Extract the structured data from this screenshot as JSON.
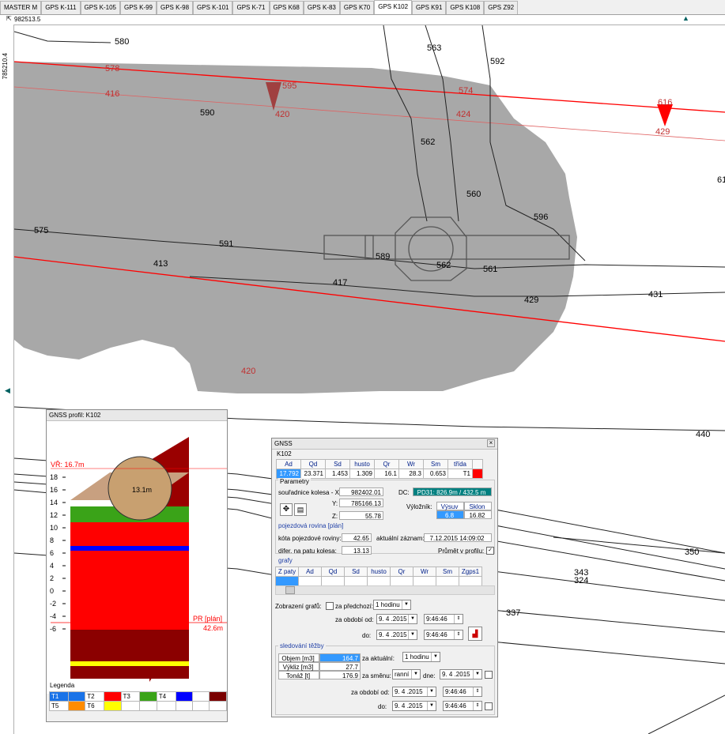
{
  "tabs": [
    "MASTER M",
    "GPS K-111",
    "GPS K-105",
    "GPS K-99",
    "GPS K-98",
    "GPS K-101",
    "GPS K-71",
    "GPS K68",
    "GPS K-83",
    "GPS K70",
    "GPS K102",
    "GPS K91",
    "GPS K108",
    "GPS Z92"
  ],
  "active_tab": "GPS K102",
  "coord_top": "982513.5",
  "coord_left": "785210.4",
  "map": {
    "contour_labels": [
      "580",
      "563",
      "592",
      "578",
      "595",
      "574",
      "616",
      "416",
      "420",
      "590",
      "424",
      "429",
      "562",
      "61",
      "560",
      "596",
      "575",
      "591",
      "589",
      "562",
      "561",
      "413",
      "417",
      "429",
      "431",
      "420",
      "440",
      "350",
      "343",
      "324",
      "337"
    ]
  },
  "profile_window": {
    "title": "GNSS profil: K102",
    "vr_label": "VŘ: 16.7m",
    "pr_label": "PR [plán]",
    "pr_value": "42.6m",
    "wheel_label": "13.1m",
    "y_ticks": [
      "18",
      "16",
      "14",
      "12",
      "10",
      "8",
      "6",
      "4",
      "2",
      "0",
      "-2",
      "-4",
      "-6"
    ],
    "legend_title": "Legenda",
    "legend": [
      {
        "name": "T1",
        "color": "#1a73e8"
      },
      {
        "name": "T2",
        "color": "#ff0000"
      },
      {
        "name": "T3",
        "color": "#3aa318"
      },
      {
        "name": "T4",
        "color": "#0000ff"
      },
      {
        "name": "",
        "color": "#7a0000"
      },
      {
        "name": "T5",
        "color": "#ff8c00"
      },
      {
        "name": "T6",
        "color": "#ffff00"
      }
    ]
  },
  "gnss_window": {
    "title": "GNSS",
    "machine": "K102",
    "top_headers": [
      "Ad",
      "Qd",
      "Sd",
      "husto",
      "Qr",
      "Wr",
      "Sm",
      "třída"
    ],
    "top_values": [
      "17.792",
      "23.371",
      "1.453",
      "1.309",
      "16.1",
      "28.3",
      "0.653",
      "T1"
    ],
    "parametry": "Parametry",
    "souradnice_label": "souřadnice kolesa - X:",
    "x": "982402.01",
    "y_label": "Y:",
    "y": "785166.13",
    "z_label": "Z:",
    "z": "55.78",
    "dc_label": "DC:",
    "dc": "PD31: 826.9m / 432.5 m",
    "vyloznik_label": "Výložník:",
    "vysuv_label": "Výsuv",
    "sklon_label": "Sklon",
    "vysuv": "6.8",
    "sklon": "16.82",
    "pojezdova_title": "pojezdová rovina [plán]",
    "kota_label": "kóta pojezdové roviny:",
    "kota": "42.65",
    "aktualni_label": "aktuální záznam:",
    "aktualni": "7.12.2015 14:09:02",
    "difer_label": "difer. na patu kolesa:",
    "difer": "13.13",
    "prumet_label": "Průmět v profilu:",
    "grafy_title": "grafy",
    "graph_headers": [
      "Z paty",
      "Ad",
      "Qd",
      "Sd",
      "husto",
      "Qr",
      "Wr",
      "Sm",
      "Zgps1"
    ],
    "zobrazeni_label": "Zobrazení grafů:",
    "za_predchozi_label": "za předchozí:",
    "za_predchozi": "1 hodinu",
    "za_obdobi_od_label": "za období od:",
    "do_label": "do:",
    "date1": "9. 4 .2015",
    "time1": "9:46:46",
    "date2": "9. 4 .2015",
    "time2": "9:46:46",
    "sledovani_title": "sledování těžby",
    "objem_label": "Objem [m3]",
    "objem": "164.7",
    "vykliz_label": "Výkliz [m3]",
    "vykliz": "27.7",
    "tonaz_label": "Tonáž [t]",
    "tonaz": "176.9",
    "za_aktualni_label": "za aktuální:",
    "za_aktualni": "1 hodinu",
    "za_smenu_label": "za směnu:",
    "smena": "ranní",
    "dne_label": "dne:",
    "dne": "9. 4 .2015",
    "date3": "9. 4 .2015",
    "time3": "9:46:46",
    "date4": "9. 4 .2015",
    "time4": "9:46:46"
  },
  "colors": {
    "red_line": "#ff0000",
    "grey_area": "#a8a8a8",
    "highlight": "#3399ff",
    "teal": "#008080"
  }
}
